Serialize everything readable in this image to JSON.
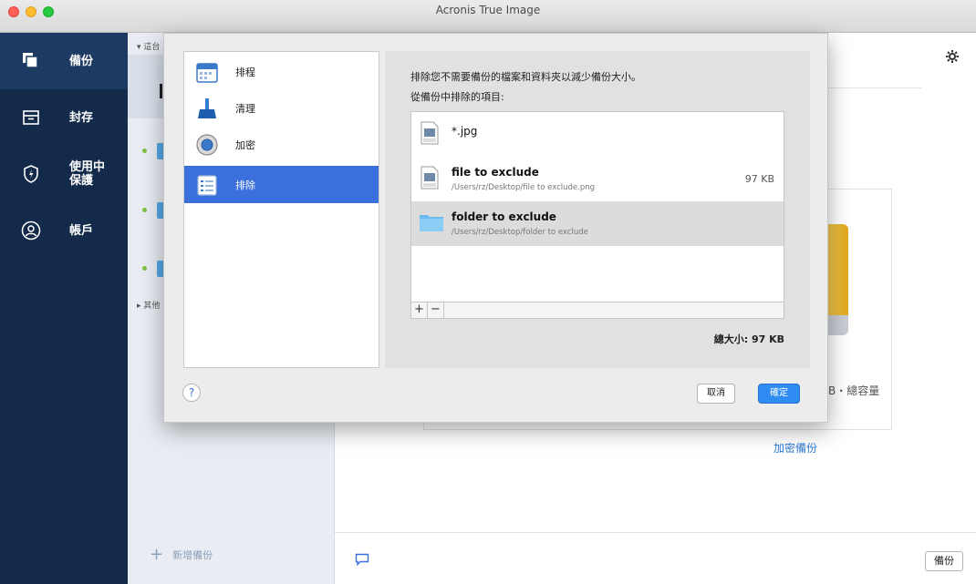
{
  "window": {
    "title": "Acronis True Image"
  },
  "nav": {
    "items": [
      {
        "label": "備份",
        "icon": "backup-copies-icon",
        "active": true
      },
      {
        "label": "封存",
        "icon": "archive-icon",
        "active": false
      },
      {
        "label": "使用中\n保護",
        "icon": "active-protection-shield-icon",
        "active": false
      },
      {
        "label": "帳戶",
        "icon": "account-person-icon",
        "active": false
      }
    ]
  },
  "backup_list": {
    "group_this": "▾ 這台",
    "group_other": "▸ 其他",
    "add_label": "新增備份"
  },
  "main": {
    "capacity_fragment": "B・總容量",
    "encrypt_link": "加密備份",
    "backup_button": "備份"
  },
  "dialog": {
    "categories": [
      {
        "label": "排程",
        "icon": "calendar-icon"
      },
      {
        "label": "清理",
        "icon": "broom-icon"
      },
      {
        "label": "加密",
        "icon": "lock-dial-icon"
      },
      {
        "label": "排除",
        "icon": "exclusion-list-icon",
        "selected": true
      }
    ],
    "description": "排除您不需要備份的檔案和資料夾以減少備份大小。",
    "items_label": "從備份中排除的項目:",
    "items": [
      {
        "name": "*.jpg",
        "path": "",
        "size": "",
        "type": "jpeg"
      },
      {
        "name": "file to exclude",
        "path": "/Users/rz/Desktop/file to exclude.png",
        "size": "97 KB",
        "type": "png"
      },
      {
        "name": "folder to exclude",
        "path": "/Users/rz/Desktop/folder to exclude",
        "size": "",
        "type": "folder"
      }
    ],
    "add_symbol": "+",
    "remove_symbol": "−",
    "total_size": "總大小: 97 KB",
    "help_symbol": "?",
    "cancel_label": "取消",
    "ok_label": "確定"
  },
  "colors": {
    "nav_bg": "#132a4a",
    "accent": "#3a6fdc",
    "ok_button": "#2f8cf3",
    "status_dot": "#7cc142"
  }
}
